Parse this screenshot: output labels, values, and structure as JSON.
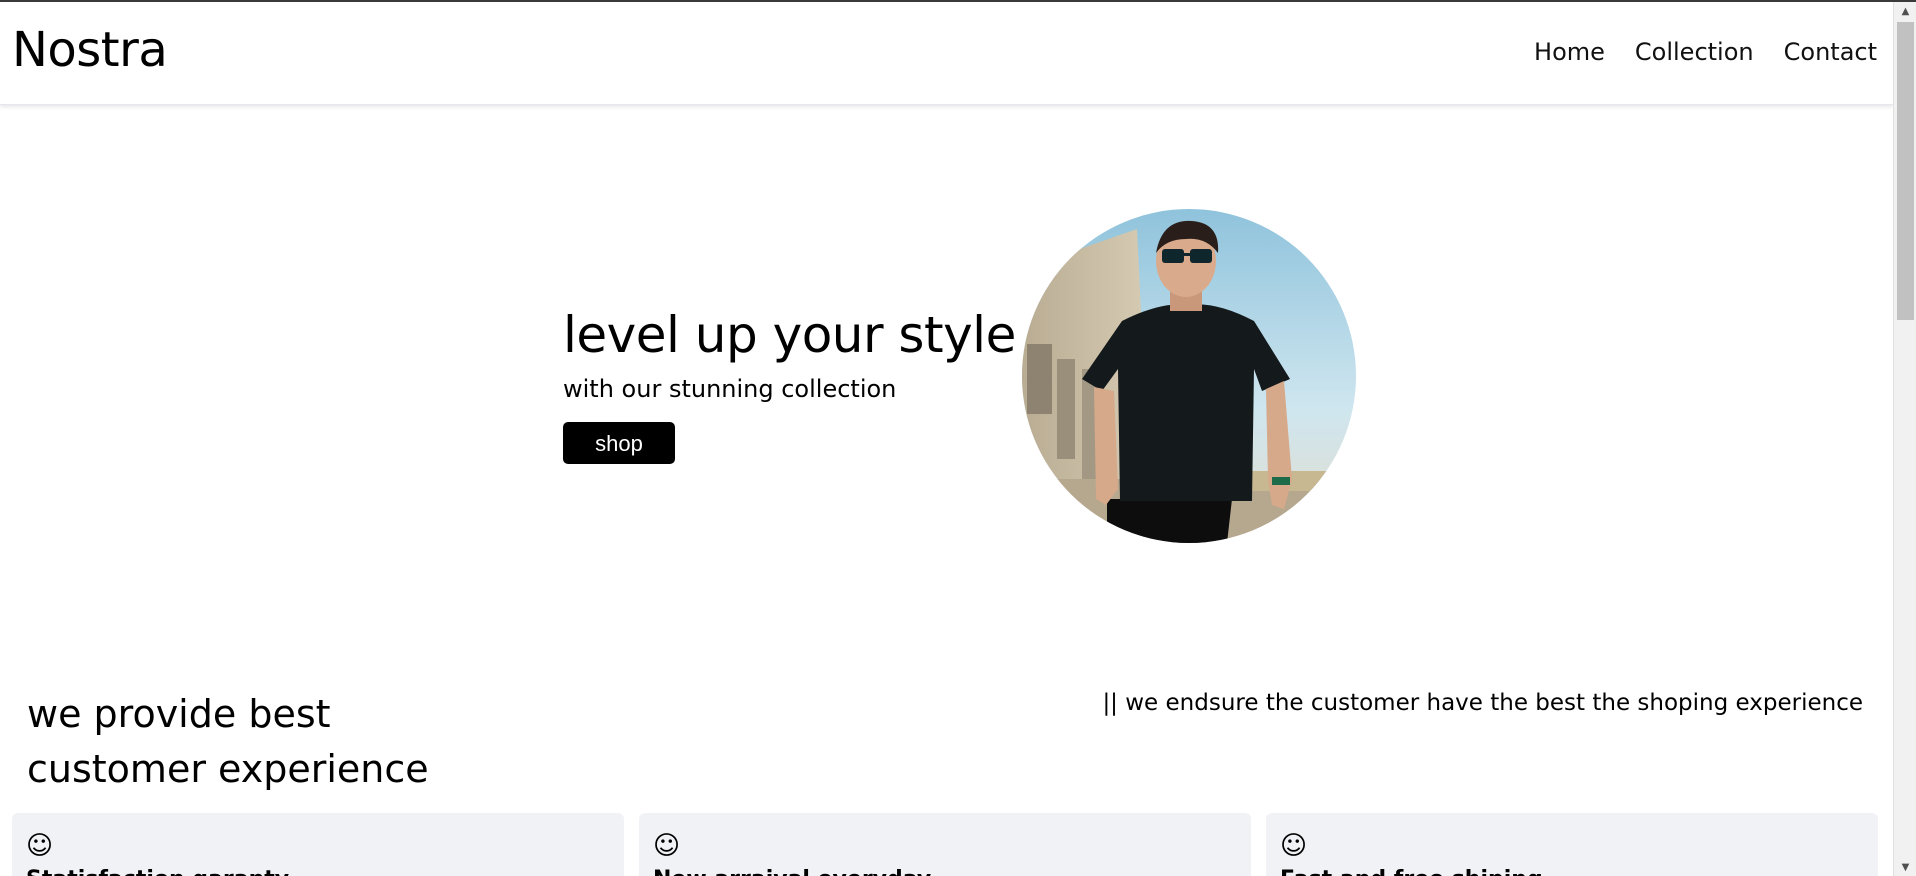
{
  "navbar": {
    "logo": "Nostra",
    "links": [
      "Home",
      "Collection",
      "Contact"
    ]
  },
  "hero": {
    "title": "level up your style",
    "subtitle": "with our stunning collection",
    "button_label": "shop",
    "image_alt": "man in black t-shirt and sunglasses"
  },
  "features": {
    "heading_line1": "we provide best",
    "heading_line2": "customer experience",
    "note": "|| we endsure the customer have the best the shoping experience",
    "cards": [
      {
        "icon": "☺",
        "title": "Statisfaction garanty"
      },
      {
        "icon": "☺",
        "title": "New arraival everyday"
      },
      {
        "icon": "☺",
        "title": "Fast and free shiping"
      }
    ]
  },
  "colors": {
    "button_bg": "#000000",
    "card_bg": "#f1f2f6"
  }
}
